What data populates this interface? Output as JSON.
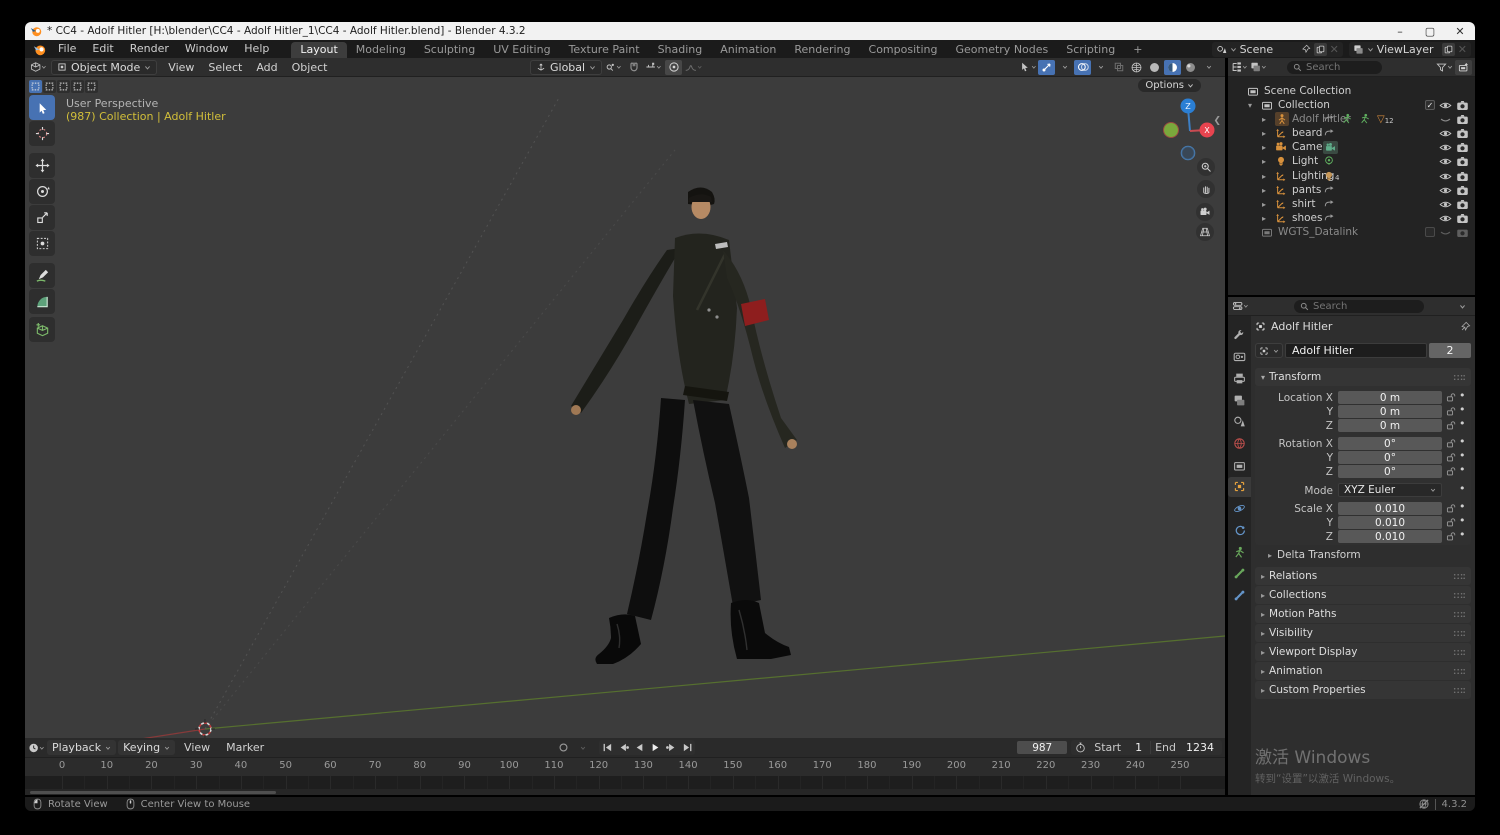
{
  "window": {
    "title": "* CC4 - Adolf Hitler [H:\\blender\\CC4 - Adolf Hitler_1\\CC4 - Adolf Hitler.blend] - Blender 4.3.2",
    "controls": {
      "minimize": "–",
      "maximize": "▢",
      "close": "✕"
    }
  },
  "topbar": {
    "menus": [
      "File",
      "Edit",
      "Render",
      "Window",
      "Help"
    ],
    "tabs": [
      "Layout",
      "Modeling",
      "Sculpting",
      "UV Editing",
      "Texture Paint",
      "Shading",
      "Animation",
      "Rendering",
      "Compositing",
      "Geometry Nodes",
      "Scripting"
    ],
    "active_tab": "Layout",
    "add_tab": "+",
    "scene_label": "Scene",
    "viewlayer_label": "ViewLayer"
  },
  "viewport": {
    "header": {
      "mode": "Object Mode",
      "menus": [
        "View",
        "Select",
        "Add",
        "Object"
      ],
      "orientation": "Global"
    },
    "options_label": "Options",
    "overlay": {
      "line1": "User Perspective",
      "line2": "(987) Collection | Adolf Hitler"
    },
    "gizmo": {
      "x": "X",
      "z": "Z"
    }
  },
  "outliner": {
    "search_placeholder": "Search",
    "rows": [
      {
        "label": "Scene Collection",
        "icon": "collection",
        "indent": 0,
        "expander": "none",
        "dim": false,
        "badges": [],
        "right": []
      },
      {
        "label": "Collection",
        "icon": "collection",
        "indent": 1,
        "expander": "open",
        "dim": false,
        "badges": [],
        "right": [
          "checkbox",
          "eye",
          "camera"
        ]
      },
      {
        "label": "Adolf Hitler",
        "icon": "armature",
        "indent": 2,
        "expander": "closed",
        "dim": true,
        "active": true,
        "badges": [
          "action",
          "pose",
          "pose",
          "mesh-count"
        ],
        "right": [
          "eye-closed",
          "camera"
        ]
      },
      {
        "label": "beard",
        "icon": "empty",
        "indent": 2,
        "expander": "closed",
        "dim": false,
        "badges": [
          "action"
        ],
        "right": [
          "eye",
          "camera"
        ]
      },
      {
        "label": "Camera",
        "icon": "camera-obj",
        "indent": 2,
        "expander": "closed",
        "dim": false,
        "badges": [
          "camera-data"
        ],
        "right": [
          "eye",
          "camera"
        ]
      },
      {
        "label": "Light",
        "icon": "light",
        "indent": 2,
        "expander": "closed",
        "dim": false,
        "badges": [
          "light-data"
        ],
        "right": [
          "eye",
          "camera"
        ]
      },
      {
        "label": "Lighting",
        "icon": "empty",
        "indent": 2,
        "expander": "closed",
        "dim": false,
        "badges": [
          "light-count"
        ],
        "right": [
          "eye",
          "camera"
        ]
      },
      {
        "label": "pants",
        "icon": "empty",
        "indent": 2,
        "expander": "closed",
        "dim": false,
        "badges": [
          "action"
        ],
        "right": [
          "eye",
          "camera"
        ]
      },
      {
        "label": "shirt",
        "icon": "empty",
        "indent": 2,
        "expander": "closed",
        "dim": false,
        "badges": [
          "action"
        ],
        "right": [
          "eye",
          "camera"
        ]
      },
      {
        "label": "shoes",
        "icon": "empty",
        "indent": 2,
        "expander": "closed",
        "dim": false,
        "badges": [
          "action"
        ],
        "right": [
          "eye",
          "camera"
        ]
      },
      {
        "label": "WGTS_Datalink",
        "icon": "collection",
        "indent": 1,
        "expander": "none",
        "dim": true,
        "badges": [],
        "right": [
          "checkbox-empty",
          "eye-closed-dim",
          "camera-dim"
        ]
      }
    ],
    "mesh_badge_count": "12",
    "light_badge_count": "4"
  },
  "properties": {
    "search_placeholder": "Search",
    "breadcrumb": "Adolf Hitler",
    "name_value": "Adolf Hitler",
    "users_count": "2",
    "tabs": [
      "tool",
      "render",
      "output",
      "view-layer",
      "scene",
      "world",
      "collection",
      "object",
      "physics",
      "constraints",
      "object-data",
      "bone",
      "bone-constraint"
    ],
    "active_tab": "object",
    "transform": {
      "title": "Transform",
      "loc_rot_rows": [
        {
          "label": "Location X",
          "value": "0 m"
        },
        {
          "label": "Y",
          "value": "0 m"
        },
        {
          "label": "Z",
          "value": "0 m"
        },
        {
          "label": "Rotation X",
          "value": "0°"
        },
        {
          "label": "Y",
          "value": "0°"
        },
        {
          "label": "Z",
          "value": "0°"
        }
      ],
      "mode_label": "Mode",
      "mode_value": "XYZ Euler",
      "scale_rows": [
        {
          "label": "Scale X",
          "value": "0.010"
        },
        {
          "label": "Y",
          "value": "0.010"
        },
        {
          "label": "Z",
          "value": "0.010"
        }
      ],
      "sub_panel": "Delta Transform"
    },
    "panels": [
      "Relations",
      "Collections",
      "Motion Paths",
      "Visibility",
      "Viewport Display",
      "Animation",
      "Custom Properties"
    ]
  },
  "timeline": {
    "menus": [
      "Playback",
      "Keying",
      "View",
      "Marker"
    ],
    "frame": "987",
    "start_label": "Start",
    "start_value": "1",
    "end_label": "End",
    "end_value": "1234",
    "ticks": [
      "0",
      "10",
      "20",
      "30",
      "40",
      "50",
      "60",
      "70",
      "80",
      "90",
      "100",
      "110",
      "120",
      "130",
      "140",
      "150",
      "160",
      "170",
      "180",
      "190",
      "200",
      "210",
      "220",
      "230",
      "240",
      "250"
    ]
  },
  "statusbar": {
    "items": [
      "Rotate View",
      "Center View to Mouse"
    ],
    "version": "4.3.2"
  },
  "watermark": {
    "line1": "激活 Windows",
    "line2": "转到“设置”以激活 Windows。"
  },
  "colors": {
    "accent": "#4772b3",
    "axis_x": "#e8444f",
    "axis_y": "#6ba832",
    "axis_z": "#2b7fd4",
    "object_orange": "#e8a33d"
  }
}
